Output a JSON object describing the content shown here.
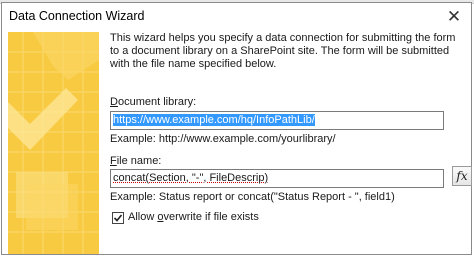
{
  "window": {
    "title": "Data Connection Wizard",
    "close_glyph": "✕"
  },
  "intro_text": "This wizard helps you specify a data connection for submitting the form to a document library on a SharePoint site. The form will be submitted with the file name specified below.",
  "library": {
    "label_prefix": "",
    "label_access_key": "D",
    "label_rest": "ocument library:",
    "value": "https://www.example.com/hq/InfoPathLib/",
    "example": "Example: http://www.example.com/yourlibrary/"
  },
  "file_name": {
    "label_access_key": "F",
    "label_rest": "ile name:",
    "value_underlined": "concat(Section, \"-\", FileDescrip)",
    "example": "Example: Status report or concat(\"Status Report - \", field1)",
    "fx_label": "fx"
  },
  "overwrite": {
    "checked": true,
    "label_before": "Allow ",
    "label_access_key": "o",
    "label_after": "verwrite if file exists"
  },
  "colors": {
    "art_base": "#f7c531",
    "art_light": "#fde79a",
    "selection": "#3399ff"
  }
}
